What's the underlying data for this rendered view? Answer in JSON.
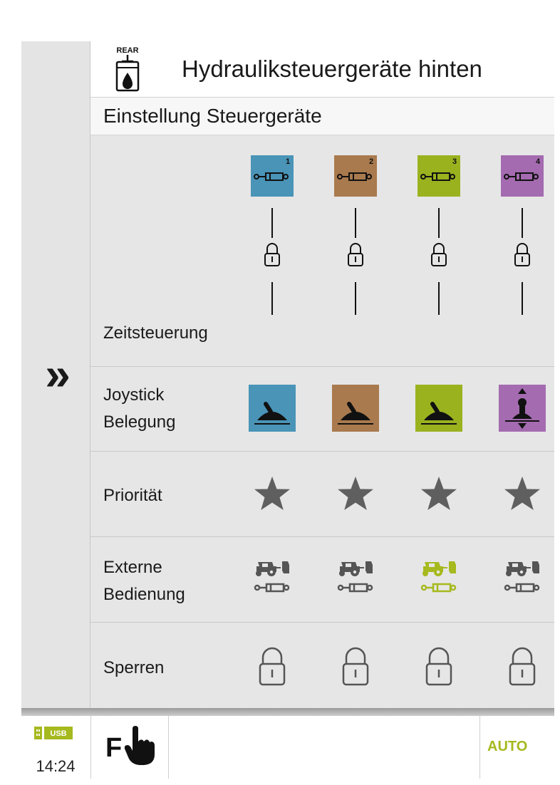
{
  "header": {
    "badge": "REAR",
    "title": "Hydrauliksteuergeräte hinten",
    "icon": "rear-hydraulic-icon"
  },
  "subheader": {
    "title": "Einstellung Steuergeräte"
  },
  "sidebar": {
    "expand_icon": "double-chevron-right-icon",
    "expand_glyph": "»"
  },
  "valves": [
    {
      "number": "1",
      "color": "#4a94b8",
      "external_active": false
    },
    {
      "number": "2",
      "color": "#a97a4e",
      "external_active": false
    },
    {
      "number": "3",
      "color": "#9bb21f",
      "external_active": true
    },
    {
      "number": "4",
      "color": "#a46bb0",
      "external_active": false
    }
  ],
  "rows": {
    "zeitsteuerung": "Zeitsteuerung",
    "joystick": [
      "Joystick",
      "Belegung"
    ],
    "prioritaet": "Priorität",
    "externe": [
      "Externe",
      "Bedienung"
    ],
    "sperren": "Sperren"
  },
  "footer": {
    "usb_label": "USB",
    "time": "14:24",
    "f_label": "F",
    "auto_label": "AUTO"
  },
  "colors": {
    "accent_green": "#a6b91e",
    "icon_grey": "#555555",
    "star_grey": "#5f5f5f"
  }
}
